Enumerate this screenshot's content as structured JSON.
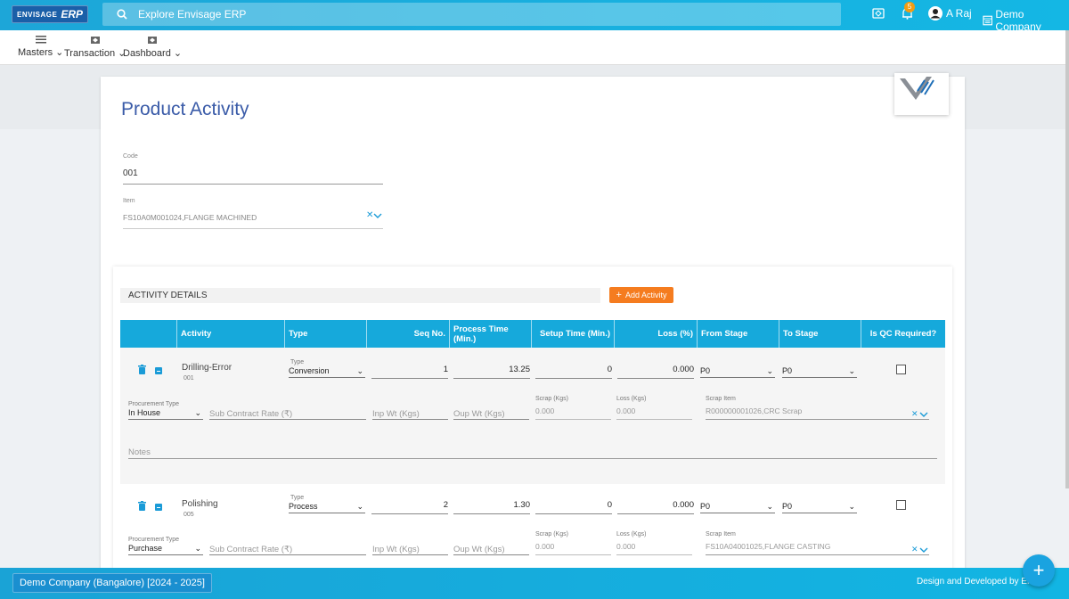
{
  "app": {
    "logo_left": "ENVISAGE",
    "logo_right": "ERP"
  },
  "search": {
    "placeholder": "Explore Envisage ERP"
  },
  "topbar": {
    "notification_count": "5",
    "user_name": "A Raj",
    "company": "Demo Company"
  },
  "menu": [
    {
      "label": "Masters",
      "icon": "hamburger-icon"
    },
    {
      "label": "Transaction",
      "icon": "transaction-icon"
    },
    {
      "label": "Dashboard",
      "icon": "dashboard-icon"
    }
  ],
  "page": {
    "title": "Product Activity",
    "code_label": "Code",
    "code_value": "001",
    "item_label": "Item",
    "item_value": "FS10A0M001024,FLANGE MACHINED"
  },
  "activity": {
    "section_title": "ACTIVITY DETAILS",
    "add_button": "Add Activity",
    "columns": [
      "Activity",
      "Type",
      "Seq No.",
      "Process Time (Min.)",
      "Setup Time (Min.)",
      "Loss (%)",
      "From Stage",
      "To Stage",
      "Is QC Required?"
    ],
    "labels": {
      "type": "Type",
      "procurement_type": "Procurement Type",
      "sub_contract_rate": "Sub Contract Rate (₹)",
      "inp_wt": "Inp Wt (Kgs)",
      "oup_wt": "Oup Wt (Kgs)",
      "scrap": "Scrap (Kgs)",
      "loss": "Loss (Kgs)",
      "scrap_item": "Scrap Item",
      "notes": "Notes"
    },
    "rows": [
      {
        "name": "Drilling-Error",
        "code": "001",
        "type": "Conversion",
        "seq": "1",
        "process_time": "13.25",
        "setup_time": "0",
        "loss_pct": "0.000",
        "from_stage": "P0",
        "to_stage": "P0",
        "procurement_type": "In House",
        "scrap_kgs": "0.000",
        "loss_kgs": "0.000",
        "scrap_item": "R000000001026,CRC Scrap"
      },
      {
        "name": "Polishing",
        "code": "005",
        "type": "Process",
        "seq": "2",
        "process_time": "1.30",
        "setup_time": "0",
        "loss_pct": "0.000",
        "from_stage": "P0",
        "to_stage": "P0",
        "procurement_type": "Purchase",
        "scrap_kgs": "0.000",
        "loss_kgs": "0.000",
        "scrap_item": "FS10A04001025,FLANGE CASTING"
      }
    ]
  },
  "footer": {
    "company_period": "Demo Company (Bangalore) [2024 - 2025]",
    "credit": "Design and Developed by EN..."
  },
  "colors": {
    "primary": "#16a9db",
    "accent": "#f57c1f",
    "title": "#3a5ba8"
  }
}
